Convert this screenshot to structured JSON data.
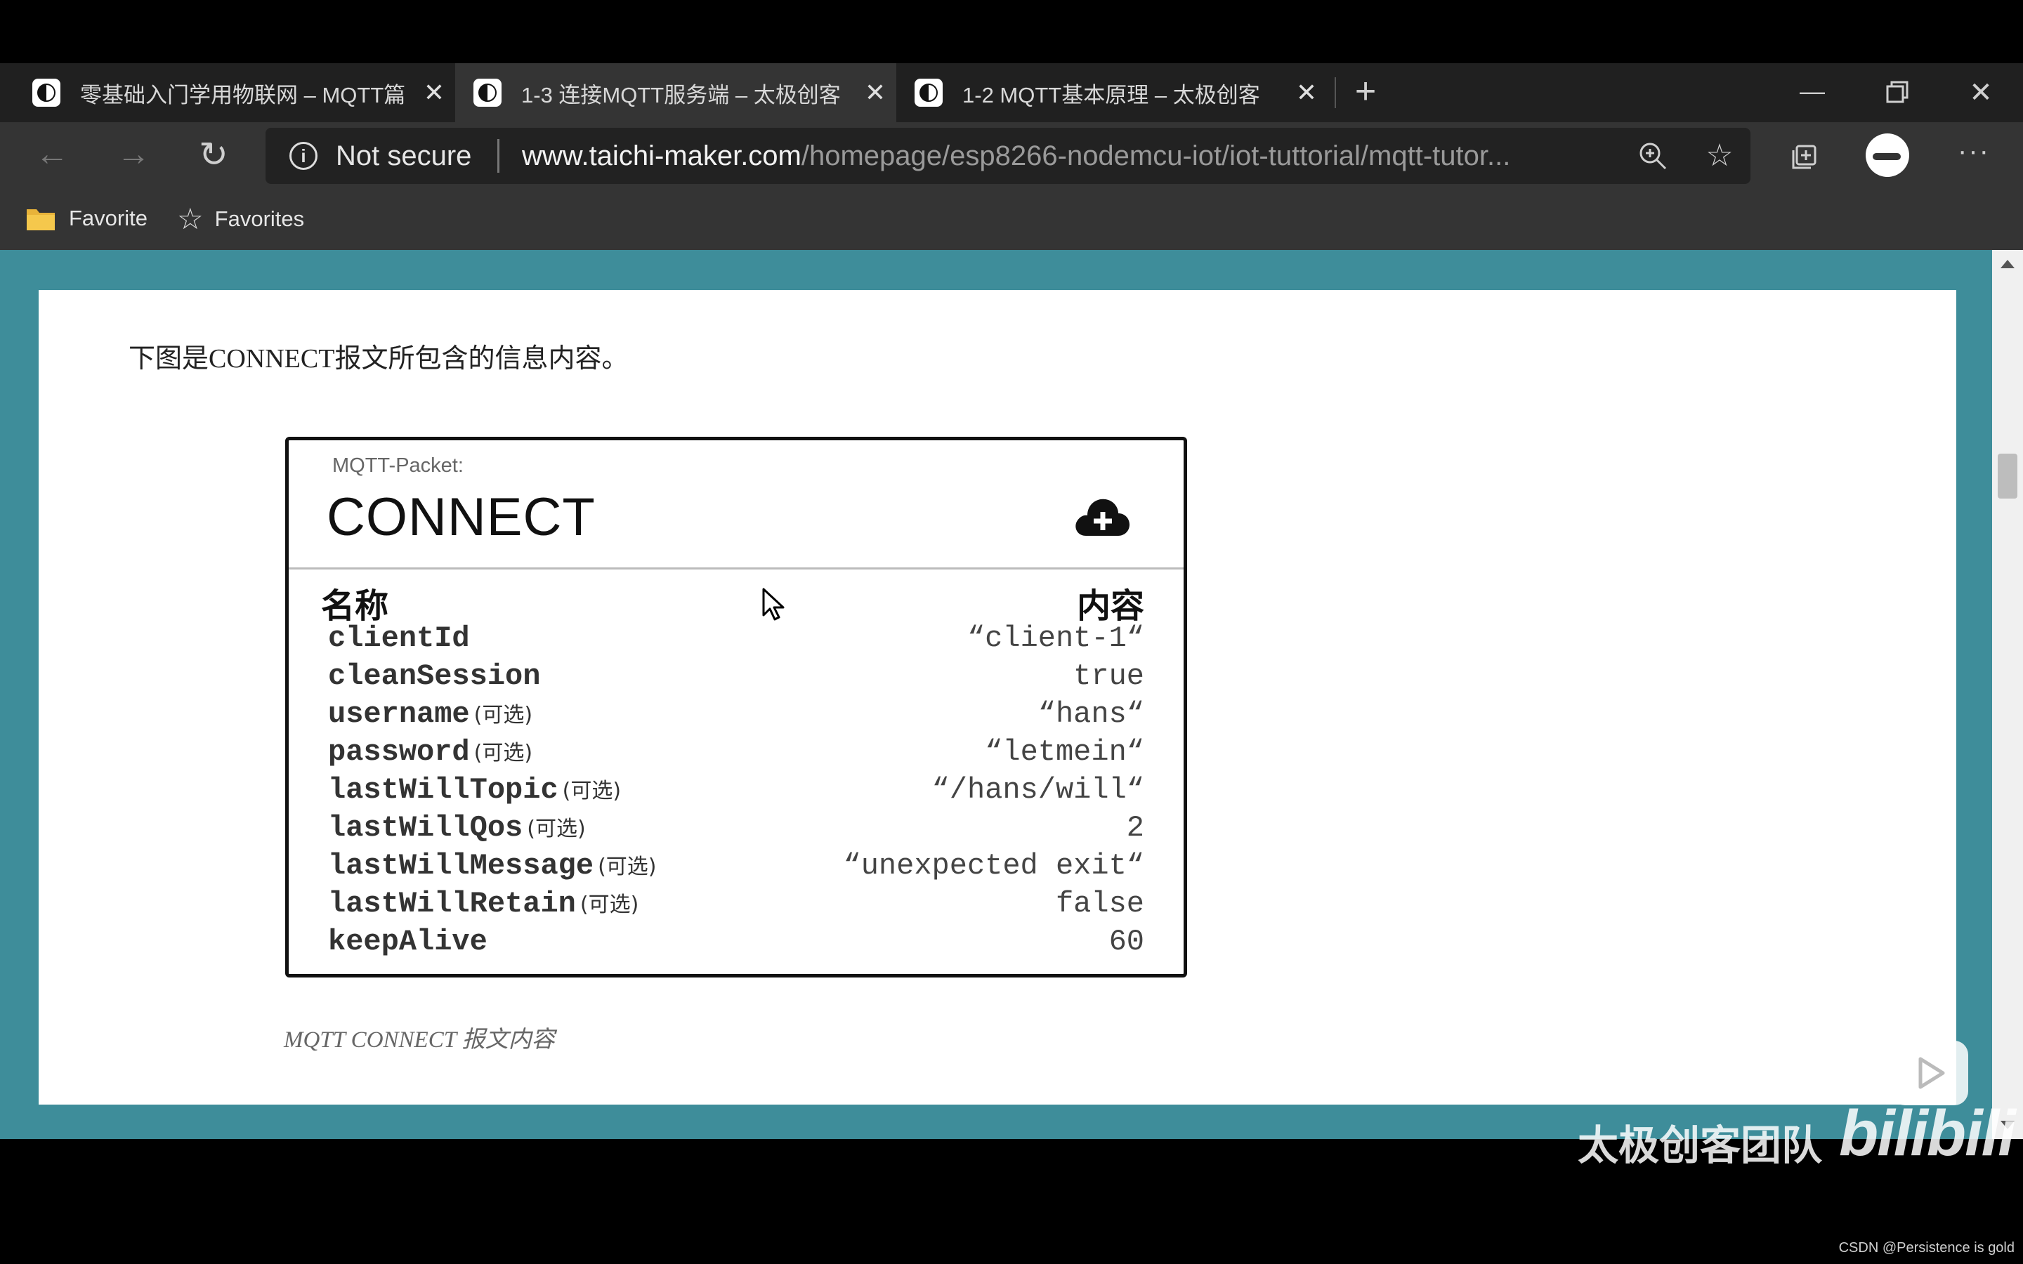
{
  "tabs": [
    {
      "title": "零基础入门学用物联网 – MQTT篇"
    },
    {
      "title": "1-3 连接MQTT服务端 – 太极创客"
    },
    {
      "title": "1-2 MQTT基本原理 – 太极创客"
    }
  ],
  "address": {
    "security": "Not secure",
    "domain": "www.taichi-maker.com",
    "path": "/homepage/esp8266-nodemcu-iot/iot-tuttorial/mqtt-tutor..."
  },
  "bookmarks": [
    {
      "label": "Favorite",
      "icon": "folder-icon"
    },
    {
      "label": "Favorites",
      "icon": "favorites-star-icon"
    }
  ],
  "article": {
    "intro": "下图是CONNECT报文所包含的信息内容。",
    "caption": "MQTT CONNECT 报文内容"
  },
  "figure": {
    "subtitle": "MQTT-Packet:",
    "title": "CONNECT",
    "col_name": "名称",
    "col_value": "内容",
    "rows": [
      {
        "name": "clientId",
        "tag": "",
        "value": "“client-1“"
      },
      {
        "name": "cleanSession",
        "tag": "",
        "value": "true"
      },
      {
        "name": "username",
        "tag": "(可选)",
        "value": "“hans“"
      },
      {
        "name": "password",
        "tag": "(可选)",
        "value": "“letmein“"
      },
      {
        "name": "lastWillTopic",
        "tag": "(可选)",
        "value": "“/hans/will“"
      },
      {
        "name": "lastWillQos",
        "tag": "(可选)",
        "value": "2"
      },
      {
        "name": "lastWillMessage",
        "tag": "(可选)",
        "value": "“unexpected exit“"
      },
      {
        "name": "lastWillRetain",
        "tag": "(可选)",
        "value": "false"
      },
      {
        "name": "keepAlive",
        "tag": "",
        "value": "60"
      }
    ]
  },
  "watermark": {
    "team": "太极创客团队",
    "brand": "bilibili",
    "credit": "CSDN @Persistence is gold"
  },
  "colors": {
    "page_background": "#3e8d9a",
    "browser_chrome": "#343434"
  }
}
